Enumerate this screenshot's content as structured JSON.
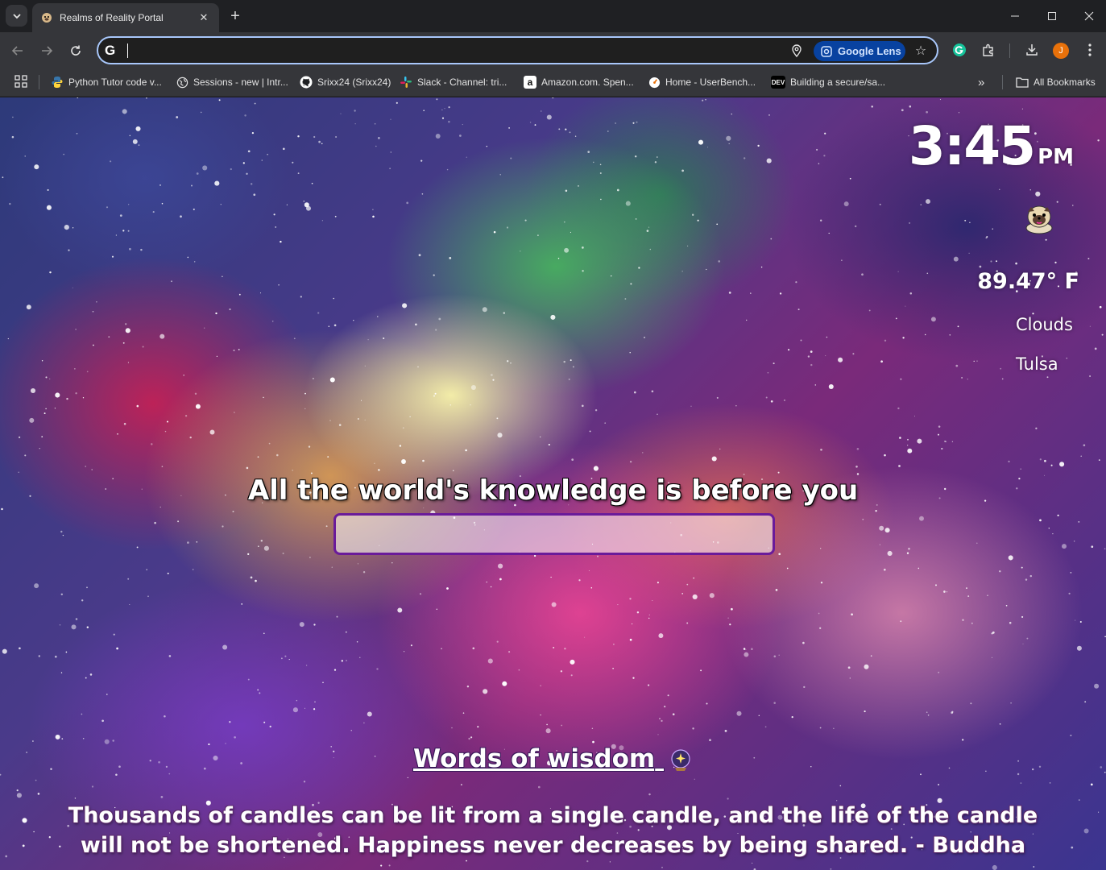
{
  "browser": {
    "tab": {
      "title": "Realms of Reality Portal",
      "close": "✕"
    },
    "new_tab": "+",
    "window": {
      "minimize": "—",
      "maximize": "☐",
      "close": "✕"
    },
    "omnibox": {
      "value": "",
      "placeholder": ""
    },
    "lens_label": "Google Lens",
    "avatar_letter": "J",
    "bookmarks": [
      {
        "label": "Python Tutor code v...",
        "icon": "python-icon"
      },
      {
        "label": "Sessions - new | Intr...",
        "icon": "globe-icon"
      },
      {
        "label": "Srixx24 (Srixx24)",
        "icon": "github-icon"
      },
      {
        "label": "Slack - Channel: tri...",
        "icon": "slack-icon"
      },
      {
        "label": "Amazon.com. Spen...",
        "icon": "amazon-icon"
      },
      {
        "label": "Home - UserBench...",
        "icon": "userbenchmark-icon"
      },
      {
        "label": "Building a secure/sa...",
        "icon": "dev-icon"
      }
    ],
    "dev_badge": "DEV",
    "amazon_badge": "a",
    "more_bookmarks": "»",
    "all_bookmarks": "All Bookmarks"
  },
  "page": {
    "clock": {
      "time": "3:45",
      "ampm": "PM"
    },
    "weather": {
      "temp": "89.47° F",
      "condition": "Clouds",
      "city": "Tulsa"
    },
    "headline": "All the world's knowledge is before you",
    "search": {
      "value": "",
      "placeholder": ""
    },
    "wisdom_title": "Words of wisdom",
    "quote": "Thousands of candles can be lit from a single candle, and the life of the candle will not be shortened. Happiness never decreases by being shared. - Buddha"
  },
  "colors": {
    "chrome_bg": "#1f2023",
    "toolbar_bg": "#35363a",
    "omnibox_border": "#a8c7fa",
    "lens_bg": "#0842a0",
    "avatar": "#e8710a",
    "search_border": "#6a1b9a"
  }
}
